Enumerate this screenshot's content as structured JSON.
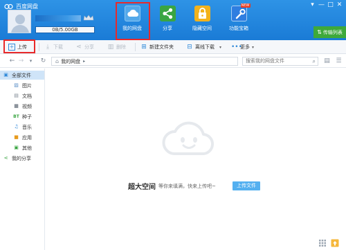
{
  "app": {
    "title": "百度网盘"
  },
  "window": {
    "controls": [
      "▾",
      "—",
      "□",
      "✕"
    ]
  },
  "user": {
    "quota_text": "0B/5.00GB",
    "quota_used_fraction": 0.0
  },
  "nav": {
    "items": [
      {
        "label": "我的网盘",
        "icon": "cloud-drive-icon",
        "active": true
      },
      {
        "label": "分享",
        "icon": "share-icon"
      },
      {
        "label": "隐藏空间",
        "icon": "lock-icon"
      },
      {
        "label": "功能宝箱",
        "icon": "toolbox-icon",
        "badge": "NEW"
      }
    ],
    "transfer_label": "传输列表"
  },
  "toolbar": {
    "upload": "上传",
    "download": "下载",
    "share": "分享",
    "delete": "删除",
    "new_folder": "新建文件夹",
    "offline_download": "离线下载",
    "more": "更多"
  },
  "address": {
    "breadcrumb": "我的网盘",
    "search_placeholder": "搜索我的网盘文件"
  },
  "sidebar": {
    "items": [
      {
        "label": "全部文件",
        "icon": "folder-icon",
        "active": true
      },
      {
        "label": "图片",
        "icon": "image-icon"
      },
      {
        "label": "文档",
        "icon": "document-icon"
      },
      {
        "label": "视频",
        "icon": "video-icon"
      },
      {
        "label": "种子",
        "icon": "torrent-icon"
      },
      {
        "label": "音乐",
        "icon": "music-icon"
      },
      {
        "label": "应用",
        "icon": "app-icon"
      },
      {
        "label": "其他",
        "icon": "other-icon"
      },
      {
        "label": "我的分享",
        "icon": "share-icon"
      }
    ]
  },
  "empty": {
    "title": "超大空间",
    "desc": "等你来填满，快来上传吧~",
    "button": "上传文件"
  },
  "colors": {
    "header": "#1f86dc",
    "highlight": "#e8292a",
    "accent_green": "#3ea93b"
  }
}
